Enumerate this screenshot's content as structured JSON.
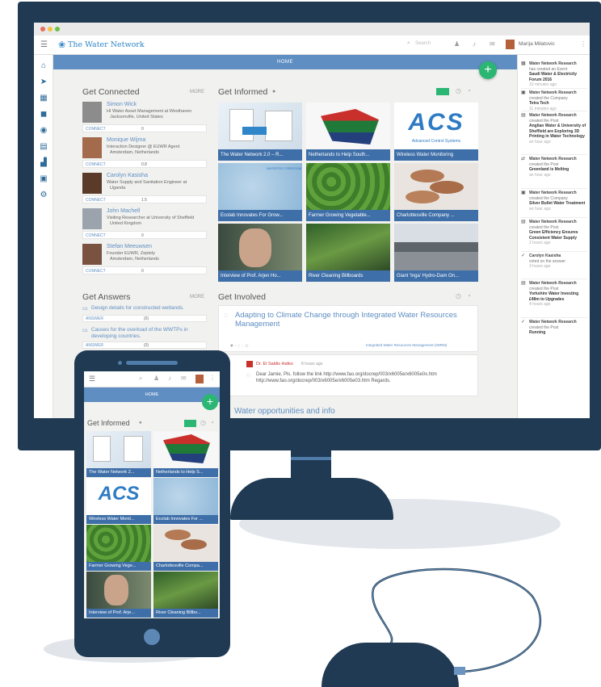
{
  "colors": {
    "frame": "#1f3a52",
    "accent_blue": "#5e8ec2",
    "caption_blue": "#3f6fa8",
    "fab_green": "#2bb673"
  },
  "desktop": {
    "app_title": "The Water Network",
    "search_placeholder": "Search",
    "user_name": "Marija Milatovic",
    "home_label": "HOME",
    "fab_label": "+",
    "connected": {
      "title": "Get Connected",
      "more": "MORE",
      "connect_label": "CONNECT",
      "people": [
        {
          "name": "Simon Wick",
          "line1": "HI Water Asset Management at Westhaven",
          "line2": "Jacksonville, United States",
          "count": "0"
        },
        {
          "name": "Monique Wijma",
          "line1": "Interaction Designer @ EUWR Agent",
          "line2": "Amsterdam, Netherlands",
          "count": "0.8"
        },
        {
          "name": "Carolyn Kasisha",
          "line1": "Water Supply and Sanitation Engineer at",
          "line2": "Uganda",
          "count": "1.5"
        },
        {
          "name": "John Machell",
          "line1": "Visiting Researcher at University of Sheffield",
          "line2": "United Kingdom",
          "count": "0"
        },
        {
          "name": "Stefan Meeuwsen",
          "line1": "Founder EUWR, Zeptely",
          "line2": "Amsterdam, Netherlands",
          "count": "0"
        }
      ]
    },
    "answers": {
      "title": "Get Answers",
      "more": "MORE",
      "answer_label": "ANSWER",
      "items": [
        {
          "q": "Design details for constructed wetlands.",
          "count": "(0)"
        },
        {
          "q": "Causes for the overload of the WWTPs in developing countries.",
          "count": "(0)"
        }
      ]
    },
    "informed": {
      "title": "Get Informed",
      "tiles": [
        {
          "caption": "The Water Network 2.0 – R..."
        },
        {
          "caption": "Netherlands to Help South..."
        },
        {
          "caption": "Wireless Water Monitoring"
        },
        {
          "caption": "Ecolab Innovates For Grow..."
        },
        {
          "caption": "Farmer Growing Vegetable..."
        },
        {
          "caption": "Charlottesville Company ..."
        },
        {
          "caption": "Interview of Prof. Arjen Ho..."
        },
        {
          "caption": "River Cleaning Billboards"
        },
        {
          "caption": "Giant 'Inga' Hydro-Dam On..."
        }
      ],
      "acs_text": "ACS",
      "acs_sub": "Advanced Control Systems",
      "tile_logo": "WATERTEC FREEDOM"
    },
    "involved": {
      "title": "Get Involved",
      "post_title": "Adapting to Climate Change through Integrated Water Resources Management",
      "post_tag": "Integrated Water Resources Management (IWRM)",
      "comment_author": "Dr. El Saldis Hafez",
      "comment_time": "8 hours ago",
      "comment_text": "Dear Jamie, Pls. follow the link http://www.fao.org/docrep/003/x6005e/x6005e0x.htm http://www.fao.org/docrep/003/x6005e/x6005e03.htm Regards.",
      "section2": "Water opportunities and info"
    },
    "activity": [
      {
        "icon": "▦",
        "actor": "Water Network Research",
        "text": "has created an Event",
        "obj": "Saudi Water & Electricity Forum 2016",
        "time": "10 minutes ago"
      },
      {
        "icon": "▣",
        "actor": "Water Network Research",
        "text": "created the Company",
        "obj": "Tetra Tech",
        "time": "11 minutes ago"
      },
      {
        "icon": "▤",
        "actor": "Water Network Research",
        "text": "created the Post",
        "obj": "Anglian Water & University of Sheffield are Exploring 3D Printing in Water Technology",
        "time": "an hour ago"
      },
      {
        "icon": "⇄",
        "actor": "Water Network Research",
        "text": "created the Post",
        "obj": "Greenland is Melting",
        "time": "an hour ago"
      },
      {
        "icon": "▣",
        "actor": "Water Network Research",
        "text": "created the Company",
        "obj": "Silver Bullet Water Treatment",
        "time": "an hour ago"
      },
      {
        "icon": "▤",
        "actor": "Water Network Research",
        "text": "created the Post",
        "obj": "Green Efficiency Ensures Consistent Water Supply",
        "time": "2 hours ago"
      },
      {
        "icon": "✓",
        "actor": "Carolyn Kasisha",
        "text": "voted on the answer",
        "obj": "",
        "time": "3 hours ago"
      },
      {
        "icon": "▤",
        "actor": "Water Network Research",
        "text": "created the Post",
        "obj": "Yorkshire Water Investing £48m to Upgrades",
        "time": "4 hours ago"
      },
      {
        "icon": "✓",
        "actor": "Water Network Research",
        "text": "created the Post",
        "obj": "Running",
        "time": ""
      }
    ]
  },
  "mobile": {
    "home_label": "HOME",
    "fab_label": "+",
    "informed_title": "Get Informed",
    "tiles": [
      {
        "caption": "The Water Network 2..."
      },
      {
        "caption": "Netherlands to Help S..."
      },
      {
        "caption": "Wireless Water Monit..."
      },
      {
        "caption": "Ecolab Innovates For ..."
      },
      {
        "caption": "Farmer Growing Vege..."
      },
      {
        "caption": "Charlottesville Compa..."
      },
      {
        "caption": "Interview of Prof. Arje..."
      },
      {
        "caption": "River Cleaning Billbo..."
      }
    ],
    "acs_text": "ACS"
  }
}
